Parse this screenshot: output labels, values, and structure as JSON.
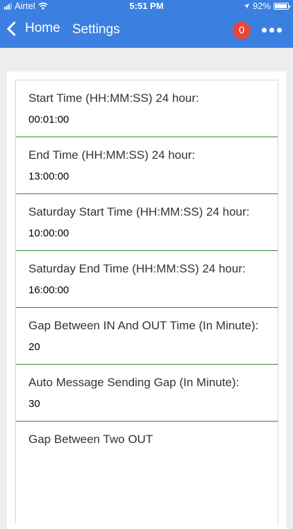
{
  "status_bar": {
    "carrier": "Airtel",
    "time": "5:51 PM",
    "battery_percent": "92%",
    "battery_level": 0.92,
    "icons": [
      "signal-icon",
      "wifi-icon",
      "location-arrow-icon",
      "battery-icon"
    ]
  },
  "nav": {
    "back_label": "Home",
    "title": "Settings",
    "badge_count": "0",
    "more_icon": "ellipsis-icon"
  },
  "colors": {
    "primary": "#3b7fe0",
    "badge": "#e8453c",
    "divider": "#2f8a2f"
  },
  "settings": [
    {
      "label": "Start Time (HH:MM:SS) 24 hour:",
      "value": "00:01:00"
    },
    {
      "label": "End Time (HH:MM:SS) 24 hour:",
      "value": "13:00:00"
    },
    {
      "label": "Saturday Start Time (HH:MM:SS) 24 hour:",
      "value": "10:00:00"
    },
    {
      "label": "Saturday End Time (HH:MM:SS) 24 hour:",
      "value": "16:00:00"
    },
    {
      "label": "Gap Between IN And OUT Time (In Minute):",
      "value": "20"
    },
    {
      "label": "Auto Message Sending Gap (In Minute):",
      "value": "30"
    },
    {
      "label": "Gap Between Two OUT",
      "value": ""
    }
  ]
}
